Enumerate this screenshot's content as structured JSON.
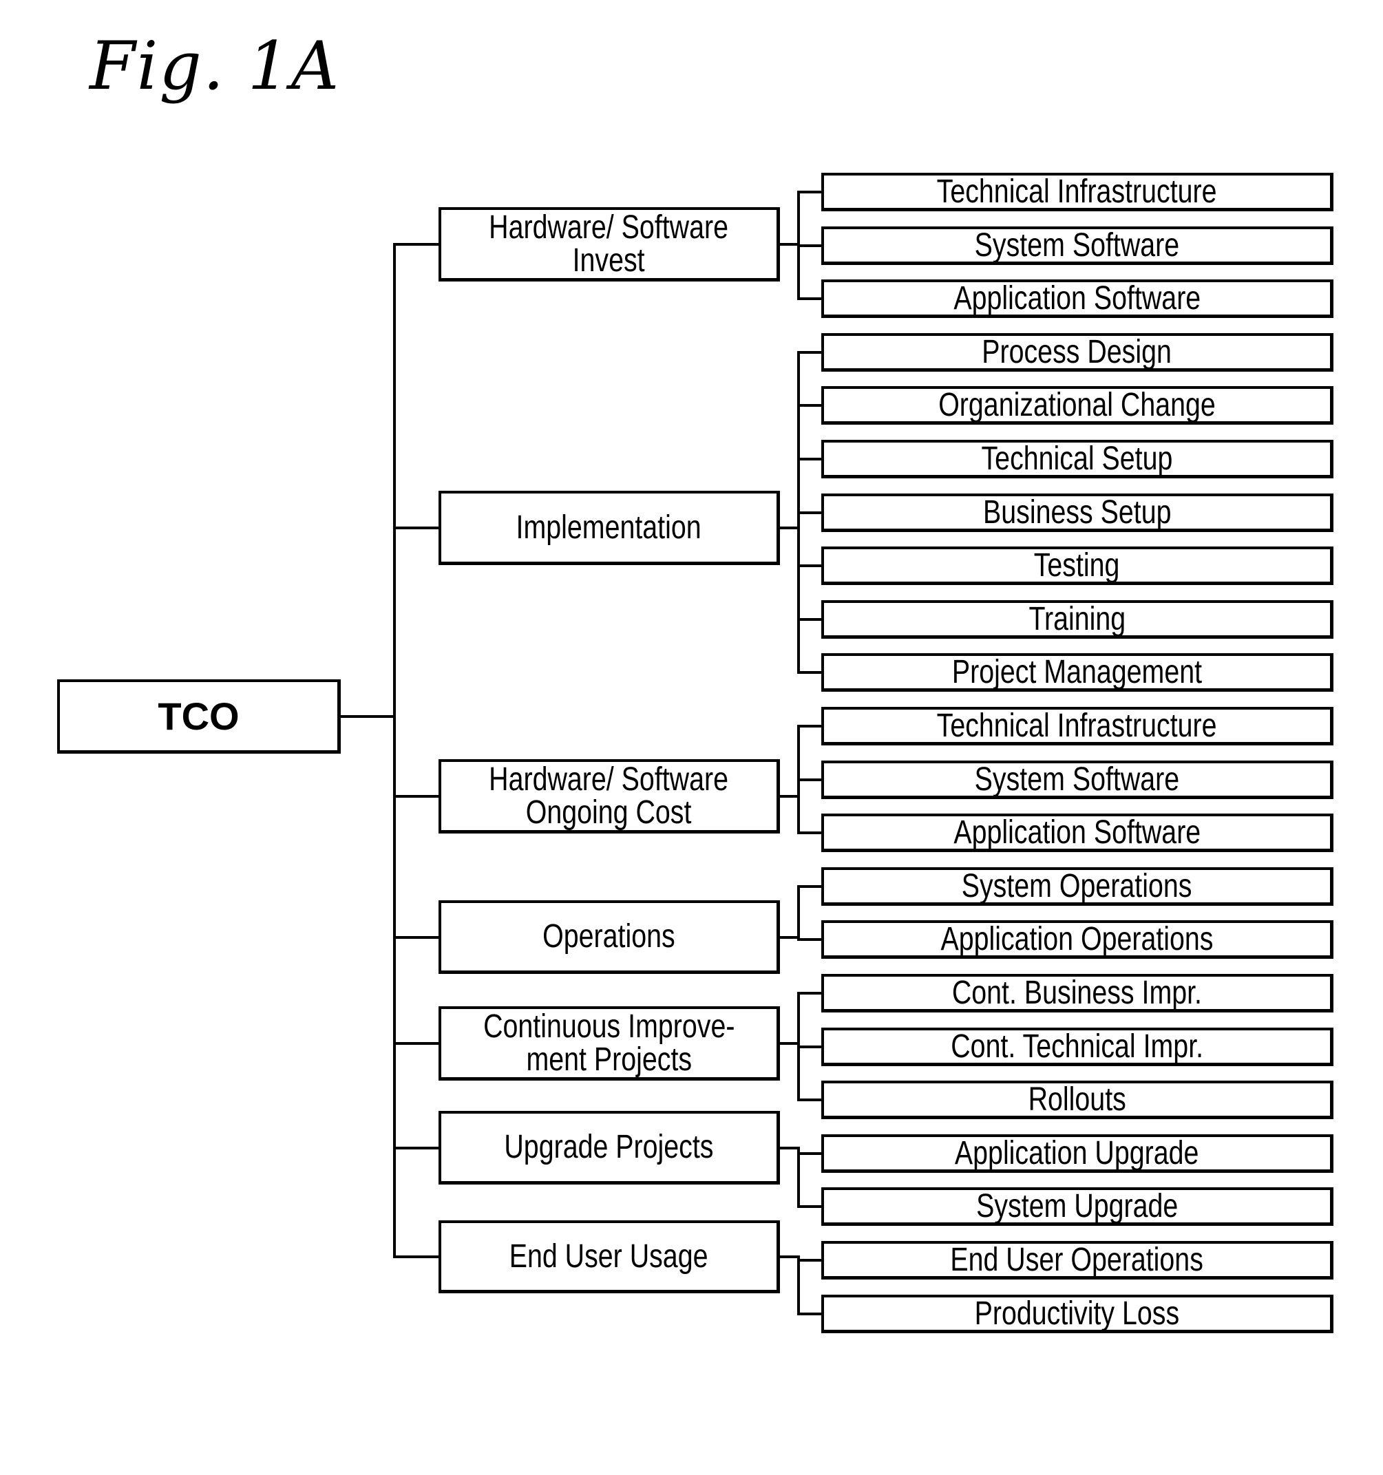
{
  "figure": {
    "title": "Fig. 1A"
  },
  "tree": {
    "root": "TCO",
    "branches": [
      {
        "label": "Hardware/ Software Invest",
        "children": [
          "Technical Infrastructure",
          "System Software",
          "Application Software"
        ]
      },
      {
        "label": "Implementation",
        "children": [
          "Process Design",
          "Organizational Change",
          "Technical Setup",
          "Business Setup",
          "Testing",
          "Training",
          "Project Management"
        ]
      },
      {
        "label": "Hardware/ Software Ongoing Cost",
        "children": [
          "Technical Infrastructure",
          "System Software",
          "Application Software"
        ]
      },
      {
        "label": "Operations",
        "children": [
          "System Operations",
          "Application Operations"
        ]
      },
      {
        "label": "Continuous Improvement Projects",
        "children": [
          "Cont. Business Impr.",
          "Cont. Technical Impr.",
          "Rollouts"
        ]
      },
      {
        "label": "Upgrade Projects",
        "children": [
          "Application Upgrade",
          "System Upgrade"
        ]
      },
      {
        "label": "End User Usage",
        "children": [
          "End User Operations",
          "Productivity Loss"
        ]
      }
    ],
    "branch_display_lines": [
      [
        "Hardware/ Software",
        "Invest"
      ],
      [
        "Implementation"
      ],
      [
        "Hardware/ Software",
        "Ongoing Cost"
      ],
      [
        "Operations"
      ],
      [
        "Continuous Improve-",
        "ment Projects"
      ],
      [
        "Upgrade Projects"
      ],
      [
        "End User Usage"
      ]
    ]
  }
}
